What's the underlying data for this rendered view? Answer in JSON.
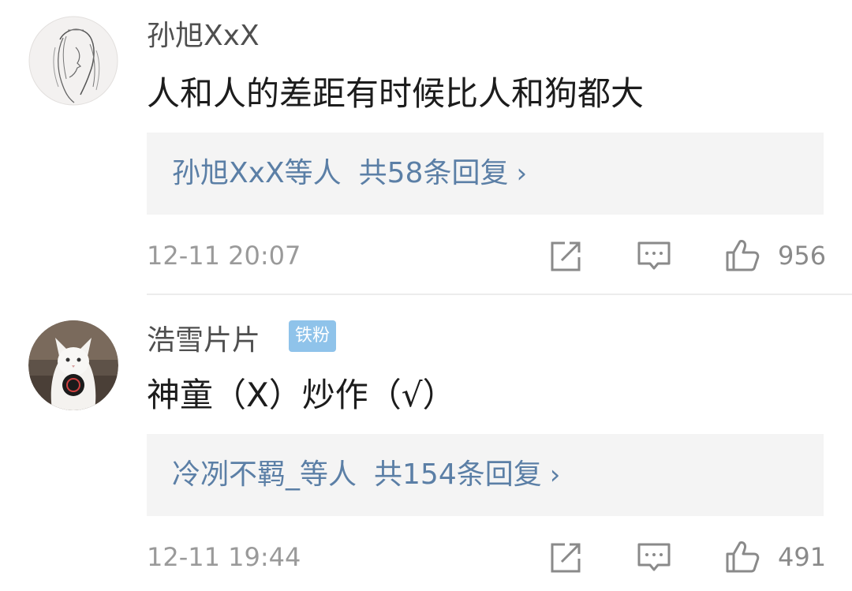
{
  "comments": [
    {
      "username": "孙旭XxX",
      "content": "人和人的差距有时候比人和狗都大",
      "reply_users": "孙旭XxX等人",
      "reply_count": "共58条回复",
      "chevron": "›",
      "timestamp": "12-11 20:07",
      "likes": "956",
      "avatar_icon": "sketch-portrait-avatar"
    },
    {
      "username": "浩雪片片",
      "badge": "铁粉",
      "content": "神童（X）炒作（√）",
      "reply_users": "冷冽不羁_等人",
      "reply_count": "共154条回复",
      "chevron": "›",
      "timestamp": "12-11 19:44",
      "likes": "491",
      "avatar_icon": "white-cat-avatar"
    }
  ],
  "colors": {
    "link": "#5b7fa6",
    "badge": "#8fc3ea",
    "meta": "#9a9a9a",
    "reply_bg": "#f4f4f4"
  },
  "icons": [
    "share-icon",
    "comment-icon",
    "thumbs-up-icon"
  ]
}
